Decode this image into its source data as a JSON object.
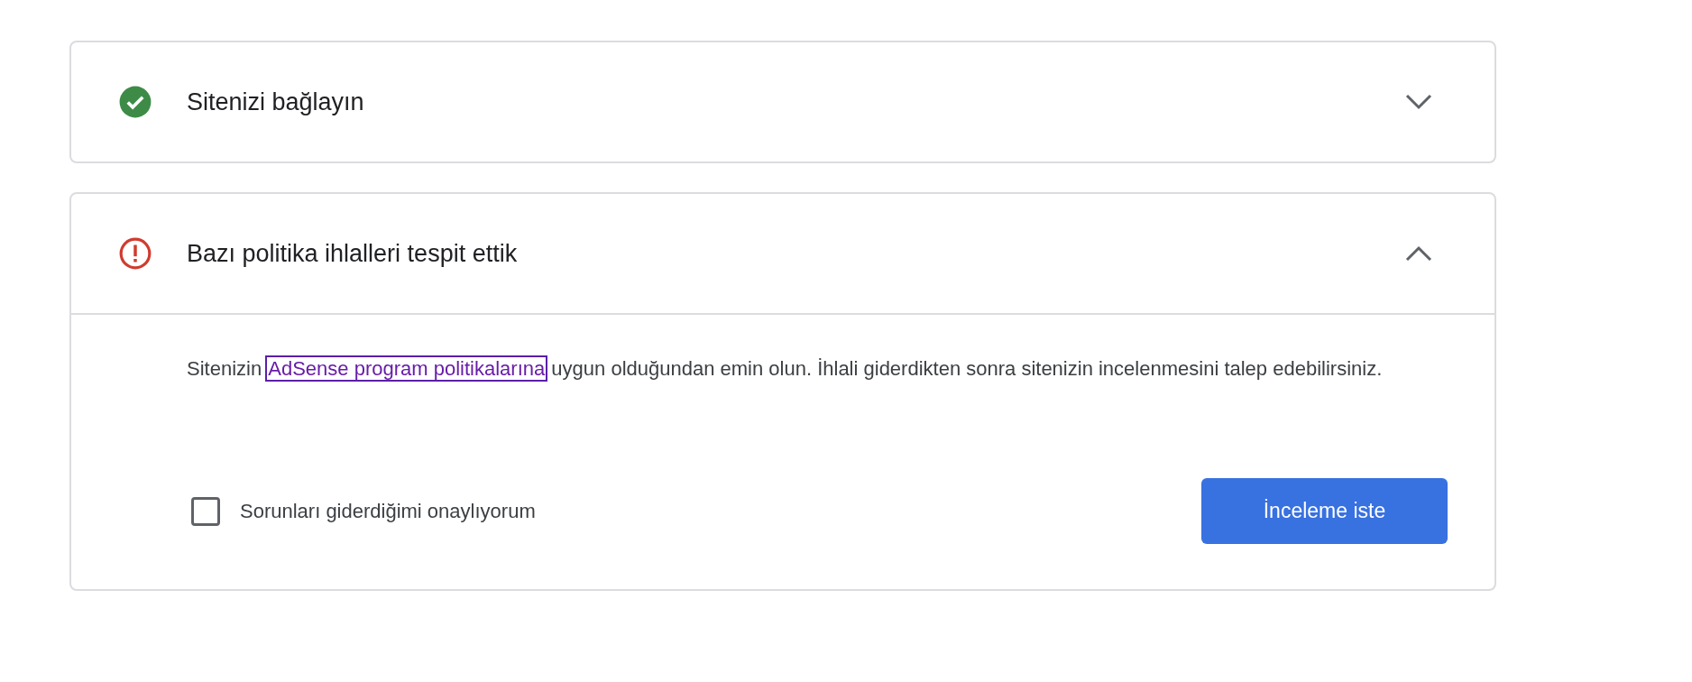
{
  "steps": [
    {
      "kind": "done",
      "title": "Sitenizi bağlayın",
      "expanded": false
    },
    {
      "kind": "error",
      "title": "Bazı politika ihlalleri tespit ettik",
      "expanded": true,
      "body": {
        "text_before": "Sitenizin",
        "link": "AdSense program politikalarına",
        "text_after": "uygun olduğundan emin olun. İhlali giderdikten sonra sitenizin incelenmesini talep edebilirsiniz.",
        "confirm": {
          "label": "Sorunları giderdiğimi onaylıyorum",
          "checked": false
        },
        "button": "İnceleme iste"
      }
    }
  ]
}
